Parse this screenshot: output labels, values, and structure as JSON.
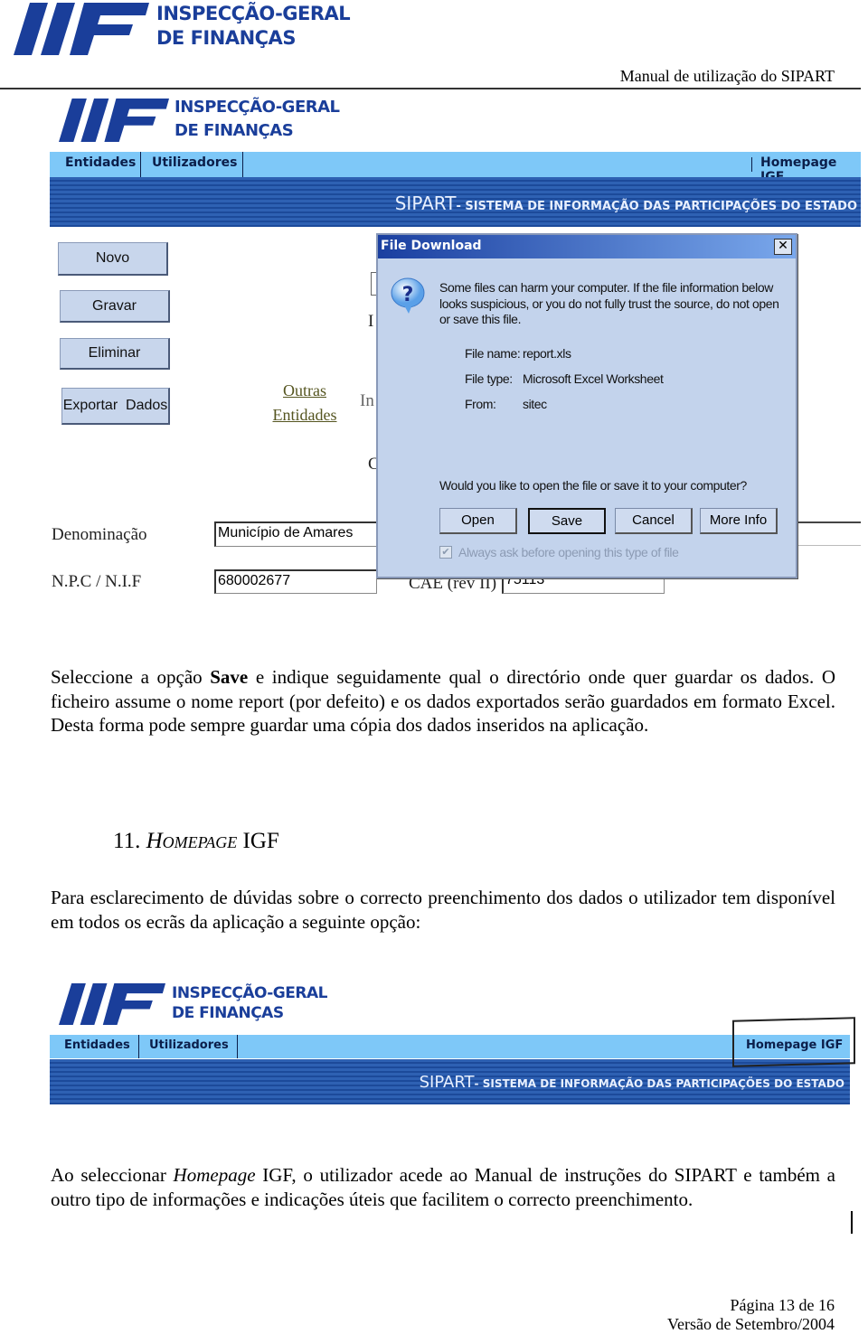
{
  "logo": {
    "line1": "INSPECÇÃO-GERAL",
    "line2": "DE FINANÇAS",
    "color": "#1a3e9a"
  },
  "header": {
    "title": "Manual de utilização do SIPART"
  },
  "app": {
    "nav": {
      "items": [
        "Entidades",
        "Utilizadores"
      ],
      "homepage": "Homepage IGF"
    },
    "banner": {
      "title": "SIPART",
      "subtitle": "- SISTEMA DE INFORMAÇÃO DAS PARTICIPAÇÕES DO ESTADO"
    },
    "buttons": {
      "novo": "Novo",
      "gravar": "Gravar",
      "eliminar": "Eliminar",
      "exportar": "Exportar  Dados"
    },
    "link": {
      "line1": "Outras",
      "line2": "Entidades"
    },
    "partial": {
      "a": "I",
      "b": "In",
      "c": "C"
    },
    "fields": {
      "denominacao_label": "Denominação",
      "denominacao_value": "Município de Amares",
      "nif_label": "N.P.C / N.I.F",
      "nif_value": "680002677",
      "cae_label": "CAE (rev II)",
      "cae_value": "75113"
    }
  },
  "dialog": {
    "title": "File Download",
    "warning": "Some files can harm your computer. If the file information below looks suspicious, or you do not fully trust the source, do not open or save this file.",
    "file_name_label": "File name:",
    "file_name": "report.xls",
    "file_type_label": "File type:",
    "file_type": "Microsoft Excel Worksheet",
    "from_label": "From:",
    "from": "sitec",
    "question": "Would you like to open the file or save it to your computer?",
    "buttons": {
      "open": "Open",
      "save": "Save",
      "cancel": "Cancel",
      "more": "More Info"
    },
    "checkbox": {
      "label": "Always ask before opening this type of file",
      "checked": true
    }
  },
  "body": {
    "p1_a": "Seleccione a opção ",
    "p1_b": "Save",
    "p1_c": " e indique seguidamente qual o directório onde quer guardar os dados. O ficheiro assume o nome report (por defeito) e os dados exportados serão guardados em formato Excel. Desta forma pode sempre guardar uma cópia dos dados inseridos na aplicação.",
    "h_num": "11. ",
    "h_em": "Homepage",
    "h_rest": " IGF",
    "p2": "Para esclarecimento de dúvidas sobre o correcto preenchimento dos dados o utilizador tem disponível em todos os ecrãs da aplicação a seguinte opção:",
    "p3_a": "Ao seleccionar ",
    "p3_em": "Homepage",
    "p3_b": " IGF, o utilizador acede ao Manual de instruções do SIPART e também a outro tipo de informações e indicações úteis que facilitem o correcto preenchimento."
  },
  "footer": {
    "page": "Página 13 de 16",
    "version": "Versão de Setembro/2004"
  }
}
